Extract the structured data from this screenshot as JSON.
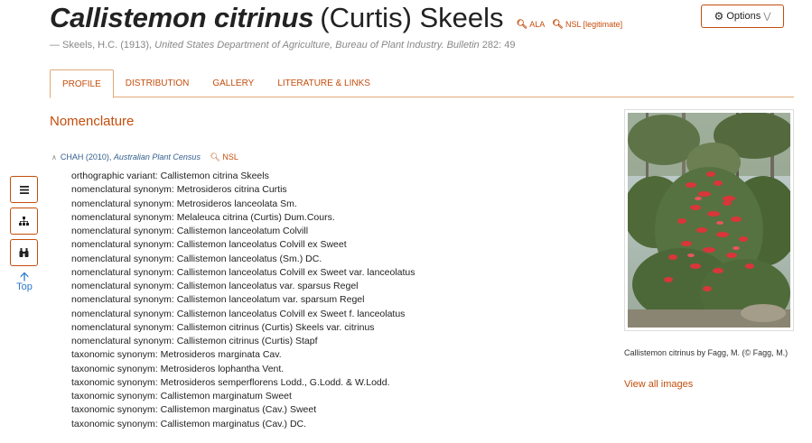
{
  "header": {
    "species": "Callistemon citrinus",
    "author": "(Curtis) Skeels",
    "links": [
      {
        "icon": "search-icon",
        "label": "ALA"
      },
      {
        "icon": "search-icon",
        "label": "NSL [legitimate]"
      }
    ],
    "citation_prefix": "— Skeels, H.C. (1913), ",
    "citation_source": "United States Department of Agriculture, Bureau of Plant Industry. Bulletin",
    "citation_suffix": " 282: 49"
  },
  "options_button": {
    "label": "Options",
    "icon": "gear-icon",
    "chevron": "double-chevron-down-icon"
  },
  "tabs": [
    {
      "label": "PROFILE",
      "active": true
    },
    {
      "label": "DISTRIBUTION",
      "active": false
    },
    {
      "label": "GALLERY",
      "active": false
    },
    {
      "label": "LITERATURE & LINKS",
      "active": false
    }
  ],
  "section": {
    "title": "Nomenclature",
    "source_prefix": "CHAH (2010), ",
    "source_name": "Australian Plant Census",
    "nsl_label": "NSL",
    "synonyms": [
      "orthographic variant: Callistemon citrina Skeels",
      "nomenclatural synonym: Metrosideros citrina Curtis",
      "nomenclatural synonym: Metrosideros lanceolata Sm.",
      "nomenclatural synonym: Melaleuca citrina (Curtis) Dum.Cours.",
      "nomenclatural synonym: Callistemon lanceolatum Colvill",
      "nomenclatural synonym: Callistemon lanceolatus Colvill ex Sweet",
      "nomenclatural synonym: Callistemon lanceolatus (Sm.) DC.",
      "nomenclatural synonym: Callistemon lanceolatus Colvill ex Sweet var. lanceolatus",
      "nomenclatural synonym: Callistemon lanceolatus var. sparsus Regel",
      "nomenclatural synonym: Callistemon lanceolatum var. sparsum Regel",
      "nomenclatural synonym: Callistemon lanceolatus Colvill ex Sweet f. lanceolatus",
      "nomenclatural synonym: Callistemon citrinus (Curtis) Skeels var. citrinus",
      "nomenclatural synonym: Callistemon citrinus (Curtis) Stapf",
      "taxonomic synonym: Metrosideros marginata Cav.",
      "taxonomic synonym: Metrosideros lophantha Vent.",
      "taxonomic synonym: Metrosideros semperflorens Lodd., G.Lodd. & W.Lodd.",
      "taxonomic synonym: Callistemon marginatum Sweet",
      "taxonomic synonym: Callistemon marginatus (Cav.) Sweet",
      "taxonomic synonym: Callistemon marginatus (Cav.) DC."
    ]
  },
  "side_tools": {
    "buttons": [
      "menu-icon",
      "sitemap-icon",
      "binoculars-icon"
    ],
    "top_label": "Top"
  },
  "image_panel": {
    "caption": "Callistemon citrinus by Fagg, M. (© Fagg, M.)",
    "view_all": "View all images"
  }
}
